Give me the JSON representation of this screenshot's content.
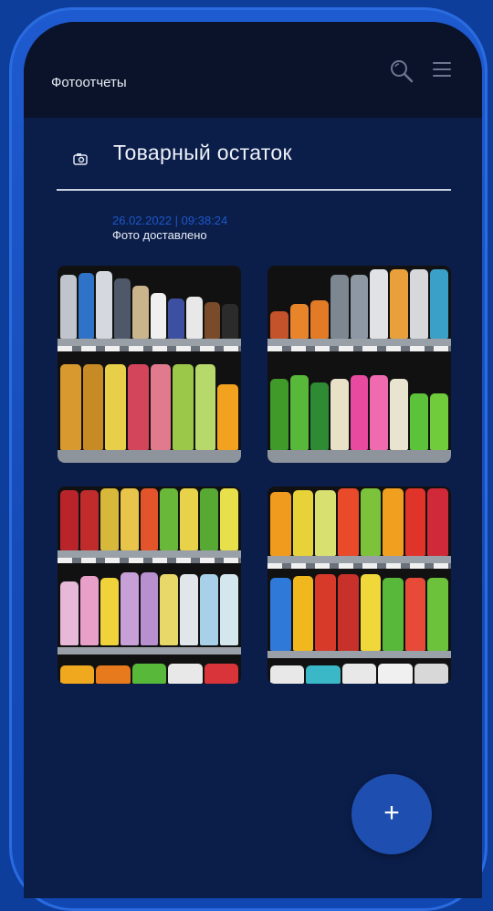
{
  "header": {
    "title": "Фотоотчеты"
  },
  "section": {
    "title": "Товарный остаток"
  },
  "report": {
    "timestamp": "26.02.2022 | 09:38:24",
    "status": "Фото доставлено"
  },
  "photos": [
    {
      "name": "shelf-photo-1"
    },
    {
      "name": "shelf-photo-2"
    },
    {
      "name": "shelf-photo-3"
    },
    {
      "name": "shelf-photo-4"
    }
  ],
  "fab": {
    "label": "+"
  },
  "colors": {
    "accent": "#1e4fb0",
    "timestamp": "#1d57c8",
    "background": "#0b1e4a",
    "topbar": "#0a1329"
  }
}
